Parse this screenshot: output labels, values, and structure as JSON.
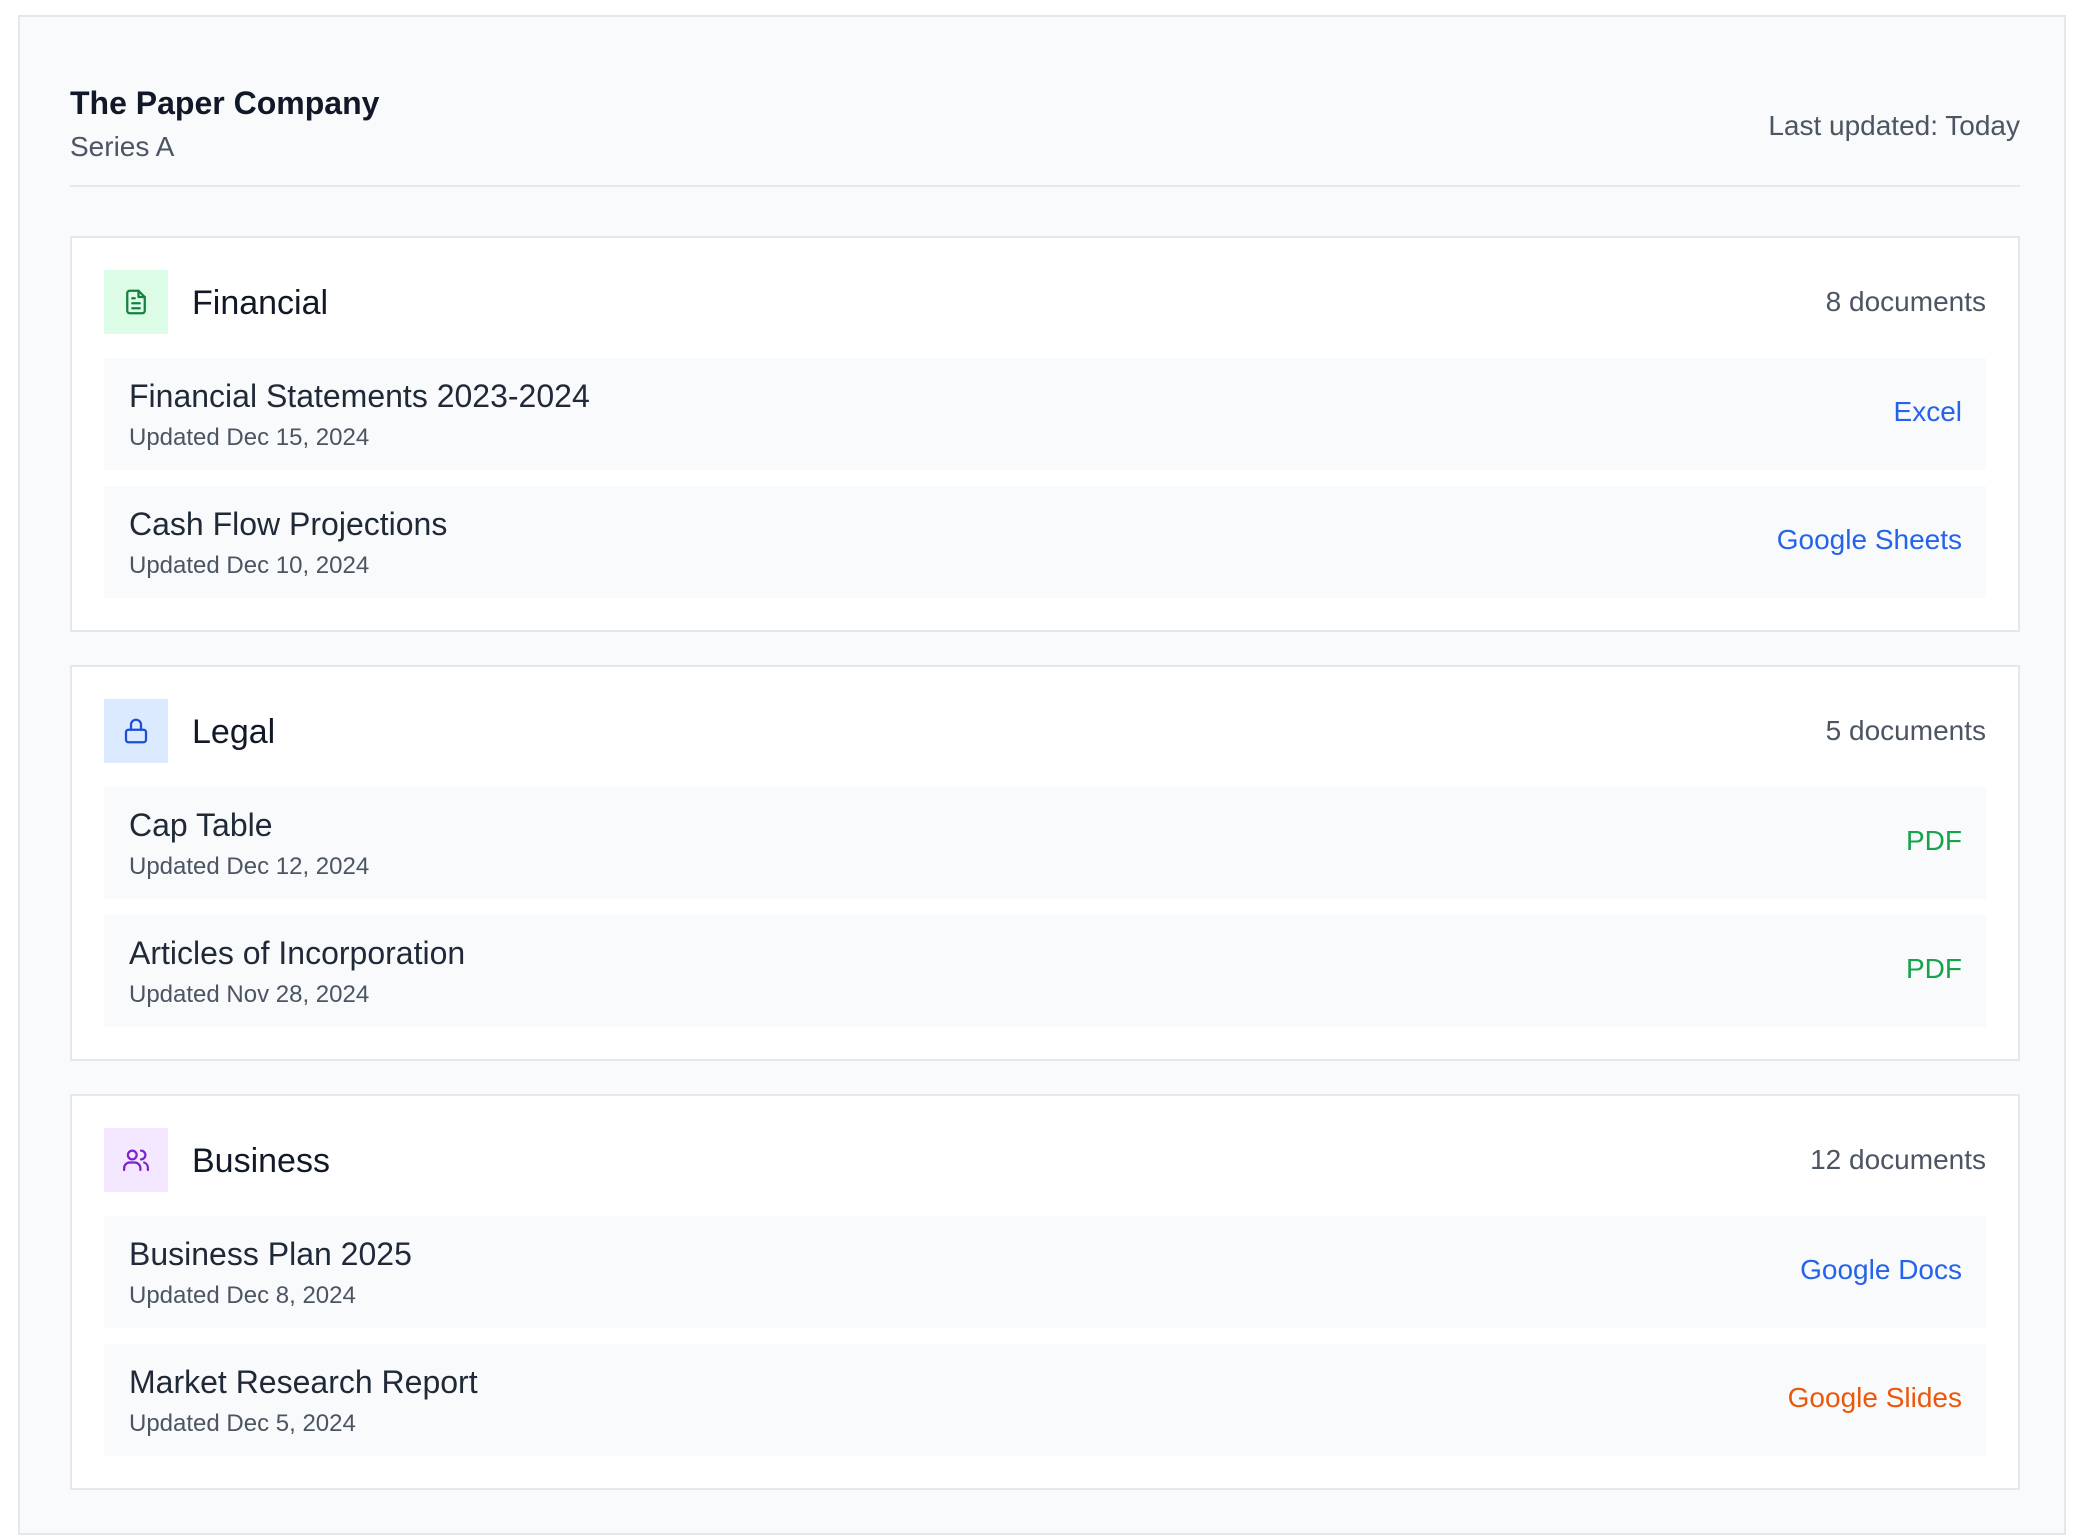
{
  "header": {
    "company_name": "The Paper Company",
    "round": "Series A",
    "last_updated": "Last updated: Today"
  },
  "sections": [
    {
      "title": "Financial",
      "count": "8 documents",
      "icon": "document-icon",
      "icon_color": "#15803d",
      "icon_bg": "#dcfce7",
      "documents": [
        {
          "title": "Financial Statements 2023-2024",
          "updated": "Updated Dec 15, 2024",
          "type": "Excel",
          "type_color": "#2563eb"
        },
        {
          "title": "Cash Flow Projections",
          "updated": "Updated Dec 10, 2024",
          "type": "Google Sheets",
          "type_color": "#2563eb"
        }
      ]
    },
    {
      "title": "Legal",
      "count": "5 documents",
      "icon": "lock-icon",
      "icon_color": "#1d4ed8",
      "icon_bg": "#dbeafe",
      "documents": [
        {
          "title": "Cap Table",
          "updated": "Updated Dec 12, 2024",
          "type": "PDF",
          "type_color": "#16a34a"
        },
        {
          "title": "Articles of Incorporation",
          "updated": "Updated Nov 28, 2024",
          "type": "PDF",
          "type_color": "#16a34a"
        }
      ]
    },
    {
      "title": "Business",
      "count": "12 documents",
      "icon": "users-icon",
      "icon_color": "#7e22ce",
      "icon_bg": "#f3e8ff",
      "documents": [
        {
          "title": "Business Plan 2025",
          "updated": "Updated Dec 8, 2024",
          "type": "Google Docs",
          "type_color": "#2563eb"
        },
        {
          "title": "Market Research Report",
          "updated": "Updated Dec 5, 2024",
          "type": "Google Slides",
          "type_color": "#ea580c"
        }
      ]
    }
  ]
}
